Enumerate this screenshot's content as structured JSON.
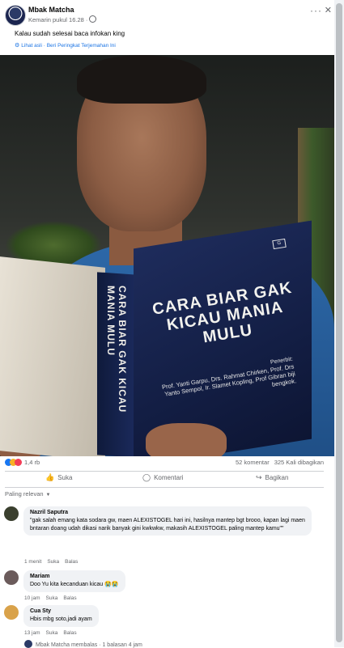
{
  "post": {
    "author": "Mbak Matcha",
    "time": "Kemarin pukul 16.28 ·",
    "caption": "Kalau sudah selesai baca infokan king",
    "translate": "Lihat asli · Beri Peringkat Terjemahan Ini",
    "more_icon": "···",
    "close_icon": "✕"
  },
  "photo": {
    "spine_title": "CARA BIAR GAK KICAU MANIA MULU",
    "cover_title": "CARA BIAR GAK KICAU MANIA MULU",
    "publisher_label": "Penerbit:",
    "publisher_names": "Prof. Yanti Garpu, Drs. Rahmat Chirken, Prof. Drs Yanto Sempol, Ir. Slamet Kopling, Prof Gibran biji bengkok.",
    "logo": "G"
  },
  "stats": {
    "reactions": "1,4 rb",
    "comments": "52 komentar",
    "shares": "325 Kali dibagikan"
  },
  "actions": {
    "like": "Suka",
    "comment": "Komentari",
    "share": "Bagikan"
  },
  "filter": "Paling relevan",
  "comments": [
    {
      "name": "Nazril Saputra",
      "text": "\"gak salah emang kata sodara gw, maen ALEXISTOGEL hari ini, hasilnya mantep bgt brooo, kapan lagi maen bntaran doang udah dikasi narik banyak gini kwkwkw, makasih ALEXISTOGEL paling mantep kamu\"\"",
      "time": "1 menit",
      "like": "Suka",
      "reply": "Balas",
      "avatar_color": "#3a3f2e"
    },
    {
      "name": "Mariam",
      "text": "Doo Yu kita kecanduan kicau 😭😭",
      "time": "10 jam",
      "like": "Suka",
      "reply": "Balas",
      "avatar_color": "#6b5b5b"
    },
    {
      "name": "Cua Sty",
      "text": "Hbis mbg soto,jadi ayam",
      "time": "13 jam",
      "like": "Suka",
      "reply": "Balas",
      "avatar_color": "#d9a24a"
    }
  ],
  "reply_summary": "Mbak Matcha membalas · 1 balasan 4 jam"
}
